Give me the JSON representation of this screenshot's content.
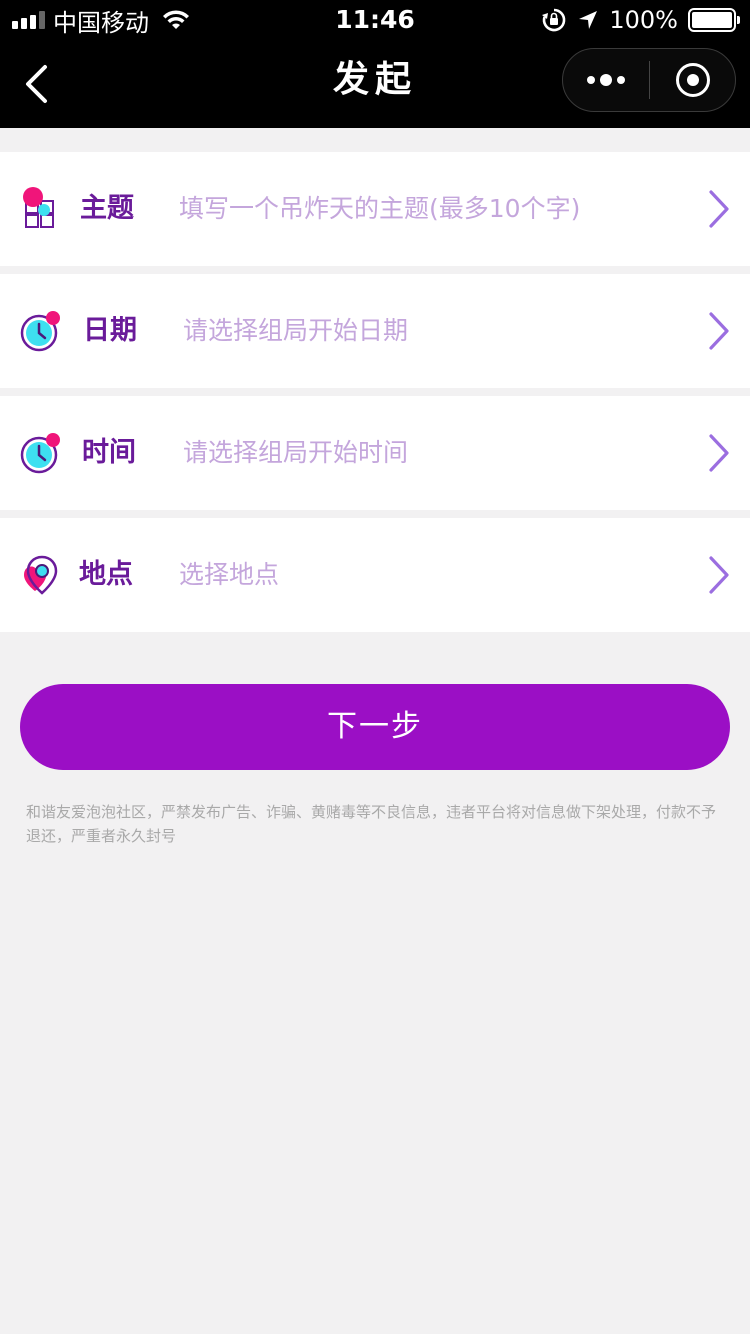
{
  "status_bar": {
    "carrier": "中国移动",
    "time": "11:46",
    "battery": "100%"
  },
  "nav": {
    "title": "发起"
  },
  "form": {
    "rows": [
      {
        "label": "主题",
        "placeholder": "填写一个吊炸天的主题(最多10个字)",
        "icon": "theme-icon"
      },
      {
        "label": "日期",
        "placeholder": "请选择组局开始日期",
        "icon": "clock-icon"
      },
      {
        "label": "时间",
        "placeholder": "请选择组局开始时间",
        "icon": "clock-icon"
      },
      {
        "label": "地点",
        "placeholder": "选择地点",
        "icon": "location-pin-icon"
      }
    ]
  },
  "next_button": "下一步",
  "notice": "和谐友爱泡泡社区，严禁发布广告、诈骗、黄赌毒等不良信息，违者平台将对信息做下架处理，付款不予退还，严重者永久封号",
  "colors": {
    "accent": "#9b0fc5",
    "label": "#6a1b9a",
    "placeholder": "#c4a6dc",
    "pink": "#f0157a",
    "cyan": "#3ee0f0"
  }
}
